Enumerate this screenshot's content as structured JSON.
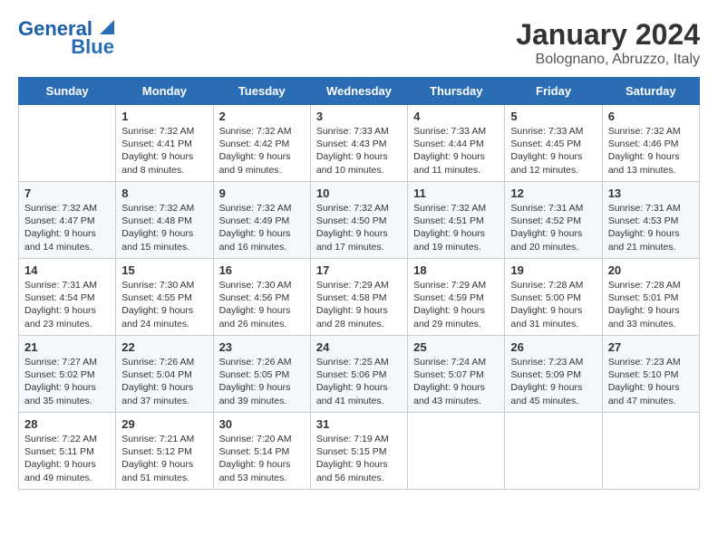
{
  "header": {
    "logo_line1": "General",
    "logo_line2": "Blue",
    "month": "January 2024",
    "location": "Bolognano, Abruzzo, Italy"
  },
  "weekdays": [
    "Sunday",
    "Monday",
    "Tuesday",
    "Wednesday",
    "Thursday",
    "Friday",
    "Saturday"
  ],
  "weeks": [
    [
      {
        "day": "",
        "info": ""
      },
      {
        "day": "1",
        "info": "Sunrise: 7:32 AM\nSunset: 4:41 PM\nDaylight: 9 hours\nand 8 minutes."
      },
      {
        "day": "2",
        "info": "Sunrise: 7:32 AM\nSunset: 4:42 PM\nDaylight: 9 hours\nand 9 minutes."
      },
      {
        "day": "3",
        "info": "Sunrise: 7:33 AM\nSunset: 4:43 PM\nDaylight: 9 hours\nand 10 minutes."
      },
      {
        "day": "4",
        "info": "Sunrise: 7:33 AM\nSunset: 4:44 PM\nDaylight: 9 hours\nand 11 minutes."
      },
      {
        "day": "5",
        "info": "Sunrise: 7:33 AM\nSunset: 4:45 PM\nDaylight: 9 hours\nand 12 minutes."
      },
      {
        "day": "6",
        "info": "Sunrise: 7:32 AM\nSunset: 4:46 PM\nDaylight: 9 hours\nand 13 minutes."
      }
    ],
    [
      {
        "day": "7",
        "info": "Sunrise: 7:32 AM\nSunset: 4:47 PM\nDaylight: 9 hours\nand 14 minutes."
      },
      {
        "day": "8",
        "info": "Sunrise: 7:32 AM\nSunset: 4:48 PM\nDaylight: 9 hours\nand 15 minutes."
      },
      {
        "day": "9",
        "info": "Sunrise: 7:32 AM\nSunset: 4:49 PM\nDaylight: 9 hours\nand 16 minutes."
      },
      {
        "day": "10",
        "info": "Sunrise: 7:32 AM\nSunset: 4:50 PM\nDaylight: 9 hours\nand 17 minutes."
      },
      {
        "day": "11",
        "info": "Sunrise: 7:32 AM\nSunset: 4:51 PM\nDaylight: 9 hours\nand 19 minutes."
      },
      {
        "day": "12",
        "info": "Sunrise: 7:31 AM\nSunset: 4:52 PM\nDaylight: 9 hours\nand 20 minutes."
      },
      {
        "day": "13",
        "info": "Sunrise: 7:31 AM\nSunset: 4:53 PM\nDaylight: 9 hours\nand 21 minutes."
      }
    ],
    [
      {
        "day": "14",
        "info": "Sunrise: 7:31 AM\nSunset: 4:54 PM\nDaylight: 9 hours\nand 23 minutes."
      },
      {
        "day": "15",
        "info": "Sunrise: 7:30 AM\nSunset: 4:55 PM\nDaylight: 9 hours\nand 24 minutes."
      },
      {
        "day": "16",
        "info": "Sunrise: 7:30 AM\nSunset: 4:56 PM\nDaylight: 9 hours\nand 26 minutes."
      },
      {
        "day": "17",
        "info": "Sunrise: 7:29 AM\nSunset: 4:58 PM\nDaylight: 9 hours\nand 28 minutes."
      },
      {
        "day": "18",
        "info": "Sunrise: 7:29 AM\nSunset: 4:59 PM\nDaylight: 9 hours\nand 29 minutes."
      },
      {
        "day": "19",
        "info": "Sunrise: 7:28 AM\nSunset: 5:00 PM\nDaylight: 9 hours\nand 31 minutes."
      },
      {
        "day": "20",
        "info": "Sunrise: 7:28 AM\nSunset: 5:01 PM\nDaylight: 9 hours\nand 33 minutes."
      }
    ],
    [
      {
        "day": "21",
        "info": "Sunrise: 7:27 AM\nSunset: 5:02 PM\nDaylight: 9 hours\nand 35 minutes."
      },
      {
        "day": "22",
        "info": "Sunrise: 7:26 AM\nSunset: 5:04 PM\nDaylight: 9 hours\nand 37 minutes."
      },
      {
        "day": "23",
        "info": "Sunrise: 7:26 AM\nSunset: 5:05 PM\nDaylight: 9 hours\nand 39 minutes."
      },
      {
        "day": "24",
        "info": "Sunrise: 7:25 AM\nSunset: 5:06 PM\nDaylight: 9 hours\nand 41 minutes."
      },
      {
        "day": "25",
        "info": "Sunrise: 7:24 AM\nSunset: 5:07 PM\nDaylight: 9 hours\nand 43 minutes."
      },
      {
        "day": "26",
        "info": "Sunrise: 7:23 AM\nSunset: 5:09 PM\nDaylight: 9 hours\nand 45 minutes."
      },
      {
        "day": "27",
        "info": "Sunrise: 7:23 AM\nSunset: 5:10 PM\nDaylight: 9 hours\nand 47 minutes."
      }
    ],
    [
      {
        "day": "28",
        "info": "Sunrise: 7:22 AM\nSunset: 5:11 PM\nDaylight: 9 hours\nand 49 minutes."
      },
      {
        "day": "29",
        "info": "Sunrise: 7:21 AM\nSunset: 5:12 PM\nDaylight: 9 hours\nand 51 minutes."
      },
      {
        "day": "30",
        "info": "Sunrise: 7:20 AM\nSunset: 5:14 PM\nDaylight: 9 hours\nand 53 minutes."
      },
      {
        "day": "31",
        "info": "Sunrise: 7:19 AM\nSunset: 5:15 PM\nDaylight: 9 hours\nand 56 minutes."
      },
      {
        "day": "",
        "info": ""
      },
      {
        "day": "",
        "info": ""
      },
      {
        "day": "",
        "info": ""
      }
    ]
  ]
}
